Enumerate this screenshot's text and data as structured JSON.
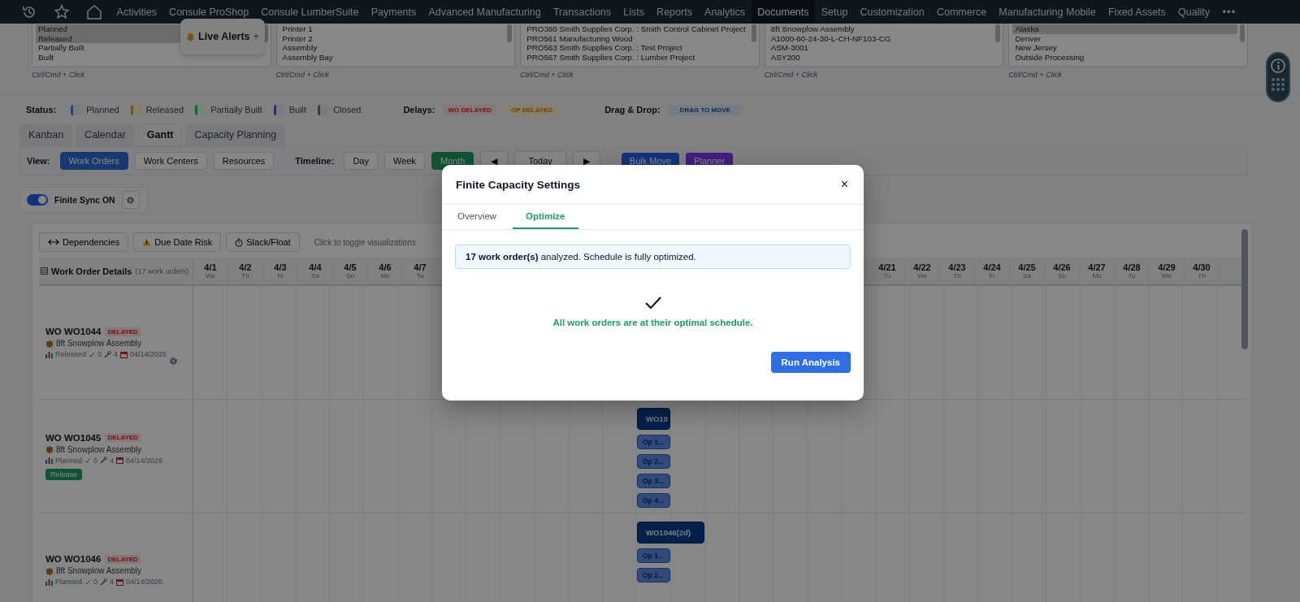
{
  "nav": {
    "items": [
      {
        "label": "Activities",
        "selected": false
      },
      {
        "label": "Consule ProShop",
        "selected": false
      },
      {
        "label": "Consule LumberSuite",
        "selected": false
      },
      {
        "label": "Payments",
        "selected": false
      },
      {
        "label": "Advanced Manufacturing",
        "selected": false
      },
      {
        "label": "Transactions",
        "selected": false
      },
      {
        "label": "Lists",
        "selected": false
      },
      {
        "label": "Reports",
        "selected": false
      },
      {
        "label": "Analytics",
        "selected": false
      },
      {
        "label": "Documents",
        "selected": true
      },
      {
        "label": "Setup",
        "selected": false
      },
      {
        "label": "Customization",
        "selected": false
      },
      {
        "label": "Commerce",
        "selected": false
      },
      {
        "label": "Manufacturing Mobile",
        "selected": false
      },
      {
        "label": "Fixed Assets",
        "selected": false
      },
      {
        "label": "Quality",
        "selected": false
      }
    ],
    "more": "•••"
  },
  "live_alerts": {
    "label": "Live Alerts",
    "action": "+"
  },
  "filters": [
    {
      "options": [
        {
          "label": "Planned",
          "selected": true
        },
        {
          "label": "Released",
          "selected": true
        },
        {
          "label": "Partially Built",
          "selected": false
        },
        {
          "label": "Built",
          "selected": false
        }
      ],
      "hint": "Ctrl/Cmd + Click"
    },
    {
      "options": [
        {
          "label": "Printer 1",
          "selected": false
        },
        {
          "label": "Printer 2",
          "selected": false
        },
        {
          "label": "Assembly",
          "selected": false
        },
        {
          "label": "Assembly Bay",
          "selected": false
        }
      ],
      "hint": "Ctrl/Cmd + Click"
    },
    {
      "options": [
        {
          "label": "PRO380 Smith Supplies Corp. : Smith Control Cabinet Project",
          "selected": false
        },
        {
          "label": "PRO561 Manufacturing Wood",
          "selected": false
        },
        {
          "label": "PRO563 Smith Supplies Corp. : Test Project",
          "selected": false
        },
        {
          "label": "PRO567 Smith Supplies Corp. : Lumber Project",
          "selected": false
        }
      ],
      "hint": "Ctrl/Cmd + Click"
    },
    {
      "options": [
        {
          "label": "8ft Snowplow Assembly",
          "selected": false
        },
        {
          "label": "A1000-60-24-30-L-CH-NF103-CG",
          "selected": false
        },
        {
          "label": "ASM-3001",
          "selected": false
        },
        {
          "label": "ASY200",
          "selected": false
        }
      ],
      "hint": "Ctrl/Cmd + Click"
    },
    {
      "options": [
        {
          "label": "Alaska",
          "selected": true
        },
        {
          "label": "Denver",
          "selected": false
        },
        {
          "label": "New Jersey",
          "selected": false
        },
        {
          "label": "Outside Processing",
          "selected": false
        }
      ],
      "hint": "Ctrl/Cmd + Click"
    }
  ],
  "legend": {
    "status_label": "Status:",
    "statuses": [
      {
        "label": "Planned",
        "kind": "planned"
      },
      {
        "label": "Released",
        "kind": "released"
      },
      {
        "label": "Partially Built",
        "kind": "partial"
      },
      {
        "label": "Built",
        "kind": "built"
      },
      {
        "label": "Closed",
        "kind": "closed"
      }
    ],
    "delays_label": "Delays:",
    "delays": [
      {
        "label": "WO DELAYED",
        "kind": "order"
      },
      {
        "label": "OP DELAYED",
        "kind": "operation"
      }
    ],
    "drag_label": "Drag & Drop:",
    "drag_badge": "DRAG TO MOVE"
  },
  "tabs": [
    {
      "label": "Kanban",
      "selected": false
    },
    {
      "label": "Calendar",
      "selected": false
    },
    {
      "label": "Gantt",
      "selected": true
    },
    {
      "label": "Capacity Planning",
      "selected": false
    }
  ],
  "toolbar": {
    "view_label": "View:",
    "views": [
      {
        "label": "Work Orders",
        "selected": true
      },
      {
        "label": "Work Centers",
        "selected": false
      },
      {
        "label": "Resources",
        "selected": false
      }
    ],
    "timeline_label": "Timeline:",
    "timelines": [
      {
        "label": "Day",
        "selected": false
      },
      {
        "label": "Week",
        "selected": false
      },
      {
        "label": "Month",
        "selected": true
      }
    ],
    "prev": "◀",
    "today": "Today",
    "next": "▶",
    "actions": [
      {
        "label": "Bulk Move",
        "kind": "bulk"
      },
      {
        "label": "Planner",
        "kind": "planner"
      }
    ]
  },
  "sync": {
    "label": "Finite Sync ON",
    "on": true
  },
  "gantt": {
    "tools": [
      {
        "label": "Dependencies",
        "kind": "dependencies"
      },
      {
        "label": "Due Date Risk",
        "kind": "risk"
      },
      {
        "label": "Slack/Float",
        "kind": "slack"
      }
    ],
    "hint": "Click to toggle visualizations",
    "details_title": "Work Order Details",
    "details_count": "(17 work orders)",
    "days_start": [
      {
        "date": "4/1",
        "weekday": "We"
      },
      {
        "date": "4/2",
        "weekday": "Th"
      },
      {
        "date": "4/3",
        "weekday": "Fr"
      },
      {
        "date": "4/4",
        "weekday": "Sa"
      },
      {
        "date": "4/5",
        "weekday": "Su"
      },
      {
        "date": "4/6",
        "weekday": "Mo"
      },
      {
        "date": "4/7",
        "weekday": "Tu"
      }
    ],
    "days_end": [
      {
        "date": "4/21",
        "weekday": "Tu"
      },
      {
        "date": "4/22",
        "weekday": "We"
      },
      {
        "date": "4/23",
        "weekday": "Th"
      },
      {
        "date": "4/24",
        "weekday": "Fr"
      },
      {
        "date": "4/25",
        "weekday": "Sa"
      },
      {
        "date": "4/26",
        "weekday": "Su"
      },
      {
        "date": "4/27",
        "weekday": "Mo"
      },
      {
        "date": "4/28",
        "weekday": "Tu"
      },
      {
        "date": "4/29",
        "weekday": "We"
      },
      {
        "date": "4/30",
        "weekday": "Th"
      }
    ],
    "rows": [
      {
        "title": "WO WO1044",
        "delayed": "DELAYED",
        "item": "8ft Snowplow Assembly",
        "status": "Released",
        "done": "0",
        "ops": "4",
        "due": "04/14/2026",
        "has_settings": true,
        "bars": []
      },
      {
        "title": "WO WO1045",
        "delayed": "DELAYED",
        "item": "8ft Snowplow Assembly",
        "status": "Planned",
        "done": "0",
        "ops": "4",
        "due": "04/14/2026",
        "action": "Release",
        "has_settings": false,
        "bars": [
          {
            "label": "WO10",
            "kind": "order"
          },
          {
            "label": "Op 1...",
            "kind": "op"
          },
          {
            "label": "Op 2...",
            "kind": "op"
          },
          {
            "label": "Op 3...",
            "kind": "op"
          },
          {
            "label": "Op 4...",
            "kind": "op"
          }
        ]
      },
      {
        "title": "WO WO1046",
        "delayed": "DELAYED",
        "item": "8ft Snowplow Assembly",
        "status": "Planned",
        "done": "0",
        "ops": "4",
        "due": "04/14/2026",
        "has_settings": false,
        "bars": [
          {
            "label": "WO1046(2d)",
            "kind": "order_wide"
          },
          {
            "label": "Op 1...",
            "kind": "op"
          },
          {
            "label": "Op 2...",
            "kind": "op"
          }
        ]
      }
    ]
  },
  "modal": {
    "title": "Finite Capacity Settings",
    "close": "×",
    "tabs": [
      {
        "label": "Overview",
        "selected": false
      },
      {
        "label": "Optimize",
        "selected": true
      }
    ],
    "banner": "**17 work order(s)** analyzed. Schedule is fully optimized.",
    "message": "All work orders are at their optimal schedule.",
    "button": "Run Analysis"
  }
}
